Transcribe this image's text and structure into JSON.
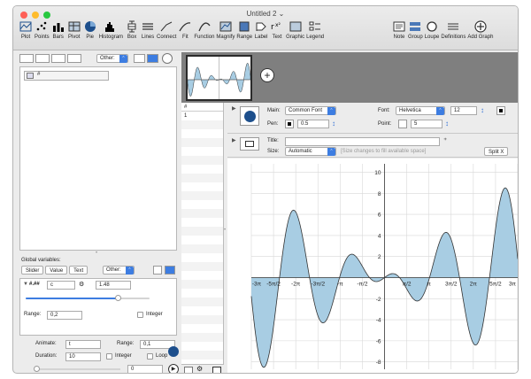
{
  "window": {
    "title": "Untitled 2",
    "title_chevron": "⌄"
  },
  "toolbar": {
    "left": [
      {
        "label": "Plot",
        "icon": "plot-icon"
      },
      {
        "label": "Points",
        "icon": "points-icon"
      },
      {
        "label": "Bars",
        "icon": "bars-icon"
      },
      {
        "label": "Pivot",
        "icon": "pivot-icon"
      },
      {
        "label": "Pie",
        "icon": "pie-icon"
      },
      {
        "label": "Histogram",
        "icon": "histogram-icon"
      },
      {
        "label": "Box",
        "icon": "box-icon"
      },
      {
        "label": "Lines",
        "icon": "lines-icon"
      },
      {
        "label": "Connect",
        "icon": "connect-icon"
      },
      {
        "label": "Fit",
        "icon": "fit-icon"
      },
      {
        "label": "Function",
        "icon": "function-icon"
      },
      {
        "label": "Magnify",
        "icon": "magnify-icon"
      },
      {
        "label": "Range",
        "icon": "range-icon"
      },
      {
        "label": "Label",
        "icon": "label-icon"
      },
      {
        "label": "Text",
        "icon": "text-icon"
      },
      {
        "label": "Graphic",
        "icon": "graphic-icon"
      },
      {
        "label": "Legend",
        "icon": "legend-icon"
      }
    ],
    "right": [
      {
        "label": "Note",
        "icon": "note-icon"
      },
      {
        "label": "Group",
        "icon": "group-icon"
      },
      {
        "label": "Loupe",
        "icon": "loupe-icon"
      },
      {
        "label": "Definitions",
        "icon": "definitions-icon"
      },
      {
        "label": "Add Graph",
        "icon": "add-graph-icon"
      }
    ]
  },
  "left_panel": {
    "type_popup": "Other:",
    "table_header": "#",
    "global_title": "Global variables:",
    "global_buttons": [
      "Slider",
      "Value",
      "Text"
    ],
    "global_popup": "Other:",
    "variable": {
      "type": "#.##",
      "name": "c",
      "value": "1.48",
      "range_label": "Range:",
      "range_value": "0,2",
      "integer_label": "Integer",
      "slider_fraction": 0.74
    },
    "animate": {
      "animate_label": "Animate:",
      "animate_value": "t",
      "range_label": "Range:",
      "range_value": "0,1",
      "duration_label": "Duration:",
      "duration_value": "10",
      "integer_label": "Integer",
      "loop_label": "Loop",
      "position_value": "0"
    }
  },
  "data_column": {
    "header": "#",
    "row1": "1"
  },
  "style_bar": {
    "main_label": "Main:",
    "main_value": "Common Font",
    "font_label": "Font:",
    "font_value": "Helvetica",
    "font_size": "12",
    "pen_label": "Pen:",
    "pen_value": "0.5",
    "point_label": "Point:",
    "point_value": "5"
  },
  "title_bar": {
    "title_label": "Title:",
    "title_value": "",
    "size_label": "Size:",
    "size_value": "Automatic",
    "size_hint": "[Size changes to fill available space]",
    "split_label": "Split X"
  },
  "chart_data": {
    "type": "area",
    "function": "x·cos(c·x) area, c = 1.48",
    "xlim": [
      -9.42478,
      9.42478
    ],
    "ylim": [
      -8.7,
      10.8
    ],
    "y_ticks": [
      10,
      8,
      6,
      4,
      2,
      -2,
      -4,
      -6,
      -8
    ],
    "x_ticks": [
      {
        "v": -9.42478,
        "label": "-3π"
      },
      {
        "v": -7.85398,
        "label": "-5π/2"
      },
      {
        "v": -6.28319,
        "label": "-2π"
      },
      {
        "v": -4.71239,
        "label": "-3π/2"
      },
      {
        "v": -3.14159,
        "label": "-π"
      },
      {
        "v": -1.5708,
        "label": "-π/2"
      },
      {
        "v": 1.5708,
        "label": "π/2"
      },
      {
        "v": 3.14159,
        "label": "π"
      },
      {
        "v": 4.71239,
        "label": "3π/2"
      },
      {
        "v": 6.28319,
        "label": "2π"
      },
      {
        "v": 7.85398,
        "label": "5π/2"
      },
      {
        "v": 9.42478,
        "label": "3π"
      }
    ],
    "points_x": [
      -9.42,
      -9.0,
      -8.6,
      -8.2,
      -7.8,
      -7.4,
      -7.0,
      -6.6,
      -6.2,
      -5.8,
      -5.4,
      -5.0,
      -4.6,
      -4.2,
      -3.8,
      -3.4,
      -3.0,
      -2.6,
      -2.2,
      -1.8,
      -1.4,
      -1.0,
      -0.6,
      -0.2,
      0.2,
      0.6,
      1.0,
      1.4,
      1.8,
      2.2,
      2.6,
      3.0,
      3.4,
      3.8,
      4.2,
      4.6,
      5.0,
      5.4,
      5.8,
      6.2,
      6.6,
      7.0,
      7.4,
      7.8,
      8.2,
      8.6,
      9.0,
      9.42
    ],
    "colors": {
      "fill": "#a8cde3",
      "stroke": "#333333",
      "grid": "#d8d8d8"
    }
  }
}
